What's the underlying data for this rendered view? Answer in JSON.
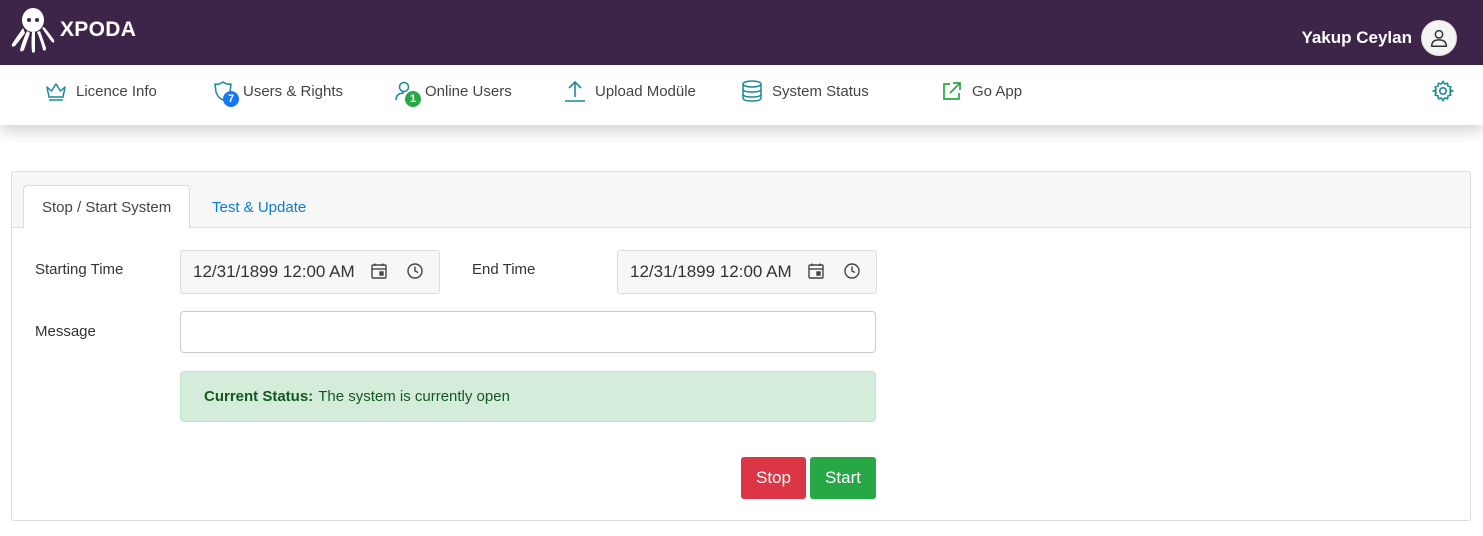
{
  "brand": {
    "name": "XPODA"
  },
  "user": {
    "name": "Yakup Ceylan"
  },
  "nav": {
    "items": [
      {
        "label": "Licence Info",
        "icon": "crown-icon"
      },
      {
        "label": "Users & Rights",
        "icon": "shield-icon",
        "badge": "7"
      },
      {
        "label": "Online Users",
        "icon": "user-icon",
        "badge": "1"
      },
      {
        "label": "Upload Modüle",
        "icon": "upload-icon"
      },
      {
        "label": "System Status",
        "icon": "database-icon"
      },
      {
        "label": "Go App",
        "icon": "external-link-icon"
      }
    ]
  },
  "tabs": [
    {
      "label": "Stop / Start System",
      "active": true
    },
    {
      "label": "Test & Update",
      "active": false
    }
  ],
  "form": {
    "starting_time_label": "Starting Time",
    "starting_time_value": "12/31/1899 12:00 AM",
    "end_time_label": "End Time",
    "end_time_value": "12/31/1899 12:00 AM",
    "message_label": "Message",
    "message_value": ""
  },
  "status": {
    "title": "Current Status:",
    "text": "The system is currently open"
  },
  "buttons": {
    "stop": "Stop",
    "start": "Start"
  },
  "colors": {
    "topbar": "#3d2549",
    "accent": "#1a8a9a",
    "stop": "#dc3545",
    "start": "#28a745",
    "link": "#0b7bd8"
  }
}
